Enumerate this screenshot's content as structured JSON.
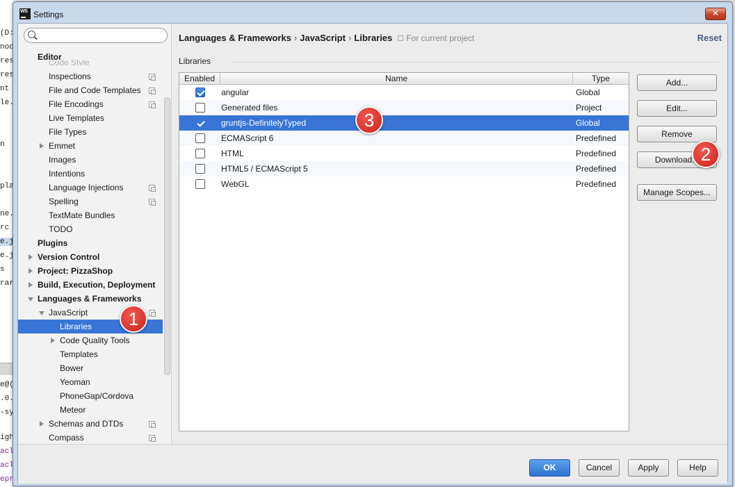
{
  "background_fragments": [
    {
      "text": "(D:",
      "cls": ""
    },
    {
      "text": "nod",
      "cls": ""
    },
    {
      "text": "ress",
      "cls": ""
    },
    {
      "text": "ress",
      "cls": ""
    },
    {
      "text": "nt",
      "cls": ""
    },
    {
      "text": "le.js",
      "cls": ""
    },
    {
      "text": "n",
      "cls": ""
    },
    {
      "text": "pla",
      "cls": ""
    },
    {
      "text": "ne.l",
      "cls": ""
    },
    {
      "text": "rc",
      "cls": ""
    },
    {
      "text": "e.js",
      "cls": "hl"
    },
    {
      "text": "e.js",
      "cls": ""
    },
    {
      "text": "s",
      "cls": ""
    },
    {
      "text": "rari",
      "cls": ""
    },
    {
      "text": "e@(",
      "cls": ""
    },
    {
      "text": ".0.",
      "cls": ""
    },
    {
      "text": "-sy",
      "cls": ""
    },
    {
      "text": "igh",
      "cls": ""
    },
    {
      "text": "acl",
      "cls": "purple"
    },
    {
      "text": "acl",
      "cls": "purple"
    },
    {
      "text": "epr",
      "cls": "purple"
    }
  ],
  "window": {
    "app_icon_text": "WS",
    "title": "Settings",
    "close_label": "✕"
  },
  "search": {
    "placeholder": "",
    "value": ""
  },
  "tree": {
    "editor": "Editor",
    "code_style_partial": "Code Style",
    "inspections": "Inspections",
    "file_code_templates": "File and Code Templates",
    "file_encodings": "File Encodings",
    "live_templates": "Live Templates",
    "file_types": "File Types",
    "emmet": "Emmet",
    "images": "Images",
    "intentions": "Intentions",
    "language_injections": "Language Injections",
    "spelling": "Spelling",
    "textmate": "TextMate Bundles",
    "todo": "TODO",
    "plugins": "Plugins",
    "version_control": "Version Control",
    "project": "Project: PizzaShop",
    "build": "Build, Execution, Deployment",
    "languages": "Languages & Frameworks",
    "javascript": "JavaScript",
    "libraries": "Libraries",
    "code_quality": "Code Quality Tools",
    "templates": "Templates",
    "bower": "Bower",
    "yeoman": "Yeoman",
    "phonegap": "PhoneGap/Cordova",
    "meteor": "Meteor",
    "schemas": "Schemas and DTDs",
    "compass": "Compass"
  },
  "header": {
    "crumb1": "Languages & Frameworks",
    "crumb2": "JavaScript",
    "crumb3": "Libraries",
    "separator": "›",
    "scope_note": "For current project",
    "reset": "Reset"
  },
  "section_label": "Libraries",
  "table": {
    "columns": {
      "enabled": "Enabled",
      "name": "Name",
      "type": "Type"
    },
    "rows": [
      {
        "name": "angular",
        "type": "Global",
        "enabled": true
      },
      {
        "name": "Generated files",
        "type": "Project",
        "enabled": false
      },
      {
        "name": "gruntjs-DefinitelyTyped",
        "type": "Global",
        "enabled": true,
        "selected": true
      },
      {
        "name": "ECMAScript 6",
        "type": "Predefined",
        "enabled": false
      },
      {
        "name": "HTML",
        "type": "Predefined",
        "enabled": false
      },
      {
        "name": "HTML5 / ECMAScript 5",
        "type": "Predefined",
        "enabled": false
      },
      {
        "name": "WebGL",
        "type": "Predefined",
        "enabled": false
      }
    ]
  },
  "side_buttons": {
    "add": "Add...",
    "edit": "Edit...",
    "remove": "Remove",
    "download": "Download...",
    "manage_scopes": "Manage Scopes..."
  },
  "badges": {
    "one": "1",
    "two": "2",
    "three": "3"
  },
  "footer": {
    "ok": "OK",
    "cancel": "Cancel",
    "apply": "Apply",
    "help": "Help"
  },
  "colors": {
    "selection": "#3875d7",
    "badge": "#d6312a",
    "primary_button": "#2f72d0",
    "reset_link": "#4a5f86"
  }
}
